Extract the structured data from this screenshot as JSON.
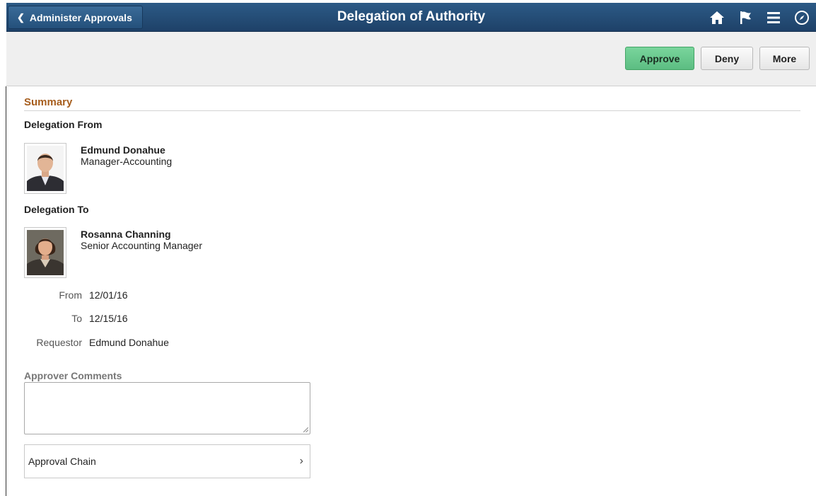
{
  "header": {
    "back_label": "Administer Approvals",
    "title": "Delegation of Authority",
    "icons": [
      "home-icon",
      "flag-icon",
      "menu-icon",
      "navbar-compass-icon"
    ]
  },
  "actions": {
    "approve_label": "Approve",
    "deny_label": "Deny",
    "more_label": "More"
  },
  "summary": {
    "title": "Summary",
    "from_label": "Delegation From",
    "from_person": {
      "name": "Edmund Donahue",
      "title": "Manager-Accounting"
    },
    "to_label": "Delegation To",
    "to_person": {
      "name": "Rosanna Channing",
      "title": "Senior Accounting Manager"
    },
    "fields": {
      "from": {
        "label": "From",
        "value": "12/01/16"
      },
      "to": {
        "label": "To",
        "value": "12/15/16"
      },
      "requestor": {
        "label": "Requestor",
        "value": "Edmund Donahue"
      }
    }
  },
  "comments": {
    "label": "Approver Comments",
    "value": ""
  },
  "approval_chain": {
    "label": "Approval Chain"
  },
  "colors": {
    "header_bg": "#24507b",
    "approve_green": "#6ac88e",
    "section_title": "#a65d1d"
  }
}
